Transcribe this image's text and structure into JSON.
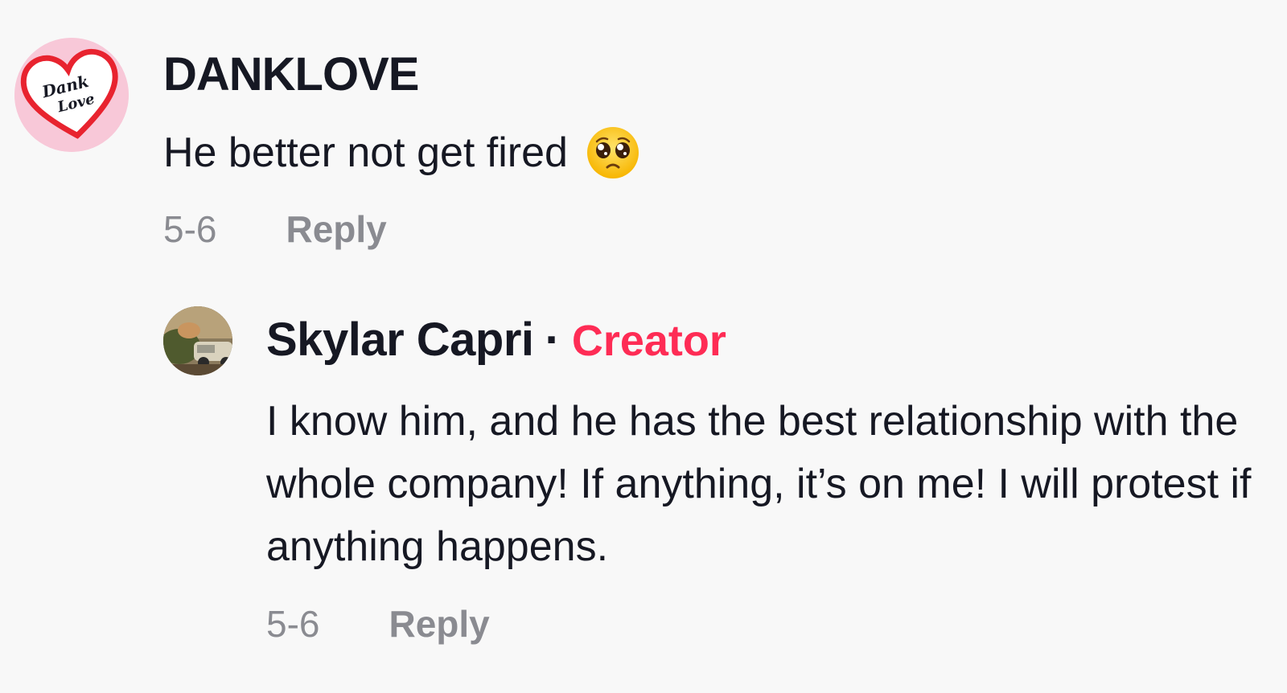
{
  "comment": {
    "avatar_icon": "dank-love-heart-icon",
    "avatar_text_line1": "Dank",
    "avatar_text_line2": "Love",
    "username": "DANKLOVE",
    "text": "He better not get fired",
    "emoji_icon": "pleading-face-emoji-icon",
    "date": "5-6",
    "reply_label": "Reply"
  },
  "reply": {
    "avatar_icon": "user-photo-avatar",
    "username": "Skylar Capri",
    "separator": "·",
    "badge": "Creator",
    "text": "I know him, and he has the best relationship with the whole company! If anything, it’s on me! I will protest if anything happens.",
    "date": "5-6",
    "reply_label": "Reply"
  },
  "colors": {
    "background": "#f8f8f8",
    "text_primary": "#161823",
    "text_secondary": "#8a8b91",
    "creator_badge": "#fe2c55",
    "avatar_bg": "#f8c8d8",
    "heart": "#e8232f"
  }
}
